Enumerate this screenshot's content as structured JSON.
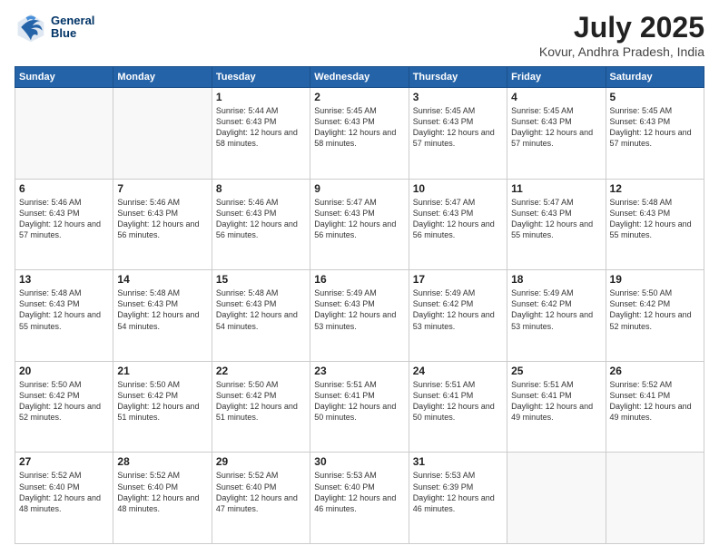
{
  "header": {
    "logo_line1": "General",
    "logo_line2": "Blue",
    "title": "July 2025",
    "subtitle": "Kovur, Andhra Pradesh, India"
  },
  "calendar": {
    "headers": [
      "Sunday",
      "Monday",
      "Tuesday",
      "Wednesday",
      "Thursday",
      "Friday",
      "Saturday"
    ],
    "rows": [
      [
        {
          "day": "",
          "text": ""
        },
        {
          "day": "",
          "text": ""
        },
        {
          "day": "1",
          "text": "Sunrise: 5:44 AM\nSunset: 6:43 PM\nDaylight: 12 hours and 58 minutes."
        },
        {
          "day": "2",
          "text": "Sunrise: 5:45 AM\nSunset: 6:43 PM\nDaylight: 12 hours and 58 minutes."
        },
        {
          "day": "3",
          "text": "Sunrise: 5:45 AM\nSunset: 6:43 PM\nDaylight: 12 hours and 57 minutes."
        },
        {
          "day": "4",
          "text": "Sunrise: 5:45 AM\nSunset: 6:43 PM\nDaylight: 12 hours and 57 minutes."
        },
        {
          "day": "5",
          "text": "Sunrise: 5:45 AM\nSunset: 6:43 PM\nDaylight: 12 hours and 57 minutes."
        }
      ],
      [
        {
          "day": "6",
          "text": "Sunrise: 5:46 AM\nSunset: 6:43 PM\nDaylight: 12 hours and 57 minutes."
        },
        {
          "day": "7",
          "text": "Sunrise: 5:46 AM\nSunset: 6:43 PM\nDaylight: 12 hours and 56 minutes."
        },
        {
          "day": "8",
          "text": "Sunrise: 5:46 AM\nSunset: 6:43 PM\nDaylight: 12 hours and 56 minutes."
        },
        {
          "day": "9",
          "text": "Sunrise: 5:47 AM\nSunset: 6:43 PM\nDaylight: 12 hours and 56 minutes."
        },
        {
          "day": "10",
          "text": "Sunrise: 5:47 AM\nSunset: 6:43 PM\nDaylight: 12 hours and 56 minutes."
        },
        {
          "day": "11",
          "text": "Sunrise: 5:47 AM\nSunset: 6:43 PM\nDaylight: 12 hours and 55 minutes."
        },
        {
          "day": "12",
          "text": "Sunrise: 5:48 AM\nSunset: 6:43 PM\nDaylight: 12 hours and 55 minutes."
        }
      ],
      [
        {
          "day": "13",
          "text": "Sunrise: 5:48 AM\nSunset: 6:43 PM\nDaylight: 12 hours and 55 minutes."
        },
        {
          "day": "14",
          "text": "Sunrise: 5:48 AM\nSunset: 6:43 PM\nDaylight: 12 hours and 54 minutes."
        },
        {
          "day": "15",
          "text": "Sunrise: 5:48 AM\nSunset: 6:43 PM\nDaylight: 12 hours and 54 minutes."
        },
        {
          "day": "16",
          "text": "Sunrise: 5:49 AM\nSunset: 6:43 PM\nDaylight: 12 hours and 53 minutes."
        },
        {
          "day": "17",
          "text": "Sunrise: 5:49 AM\nSunset: 6:42 PM\nDaylight: 12 hours and 53 minutes."
        },
        {
          "day": "18",
          "text": "Sunrise: 5:49 AM\nSunset: 6:42 PM\nDaylight: 12 hours and 53 minutes."
        },
        {
          "day": "19",
          "text": "Sunrise: 5:50 AM\nSunset: 6:42 PM\nDaylight: 12 hours and 52 minutes."
        }
      ],
      [
        {
          "day": "20",
          "text": "Sunrise: 5:50 AM\nSunset: 6:42 PM\nDaylight: 12 hours and 52 minutes."
        },
        {
          "day": "21",
          "text": "Sunrise: 5:50 AM\nSunset: 6:42 PM\nDaylight: 12 hours and 51 minutes."
        },
        {
          "day": "22",
          "text": "Sunrise: 5:50 AM\nSunset: 6:42 PM\nDaylight: 12 hours and 51 minutes."
        },
        {
          "day": "23",
          "text": "Sunrise: 5:51 AM\nSunset: 6:41 PM\nDaylight: 12 hours and 50 minutes."
        },
        {
          "day": "24",
          "text": "Sunrise: 5:51 AM\nSunset: 6:41 PM\nDaylight: 12 hours and 50 minutes."
        },
        {
          "day": "25",
          "text": "Sunrise: 5:51 AM\nSunset: 6:41 PM\nDaylight: 12 hours and 49 minutes."
        },
        {
          "day": "26",
          "text": "Sunrise: 5:52 AM\nSunset: 6:41 PM\nDaylight: 12 hours and 49 minutes."
        }
      ],
      [
        {
          "day": "27",
          "text": "Sunrise: 5:52 AM\nSunset: 6:40 PM\nDaylight: 12 hours and 48 minutes."
        },
        {
          "day": "28",
          "text": "Sunrise: 5:52 AM\nSunset: 6:40 PM\nDaylight: 12 hours and 48 minutes."
        },
        {
          "day": "29",
          "text": "Sunrise: 5:52 AM\nSunset: 6:40 PM\nDaylight: 12 hours and 47 minutes."
        },
        {
          "day": "30",
          "text": "Sunrise: 5:53 AM\nSunset: 6:40 PM\nDaylight: 12 hours and 46 minutes."
        },
        {
          "day": "31",
          "text": "Sunrise: 5:53 AM\nSunset: 6:39 PM\nDaylight: 12 hours and 46 minutes."
        },
        {
          "day": "",
          "text": ""
        },
        {
          "day": "",
          "text": ""
        }
      ]
    ]
  }
}
